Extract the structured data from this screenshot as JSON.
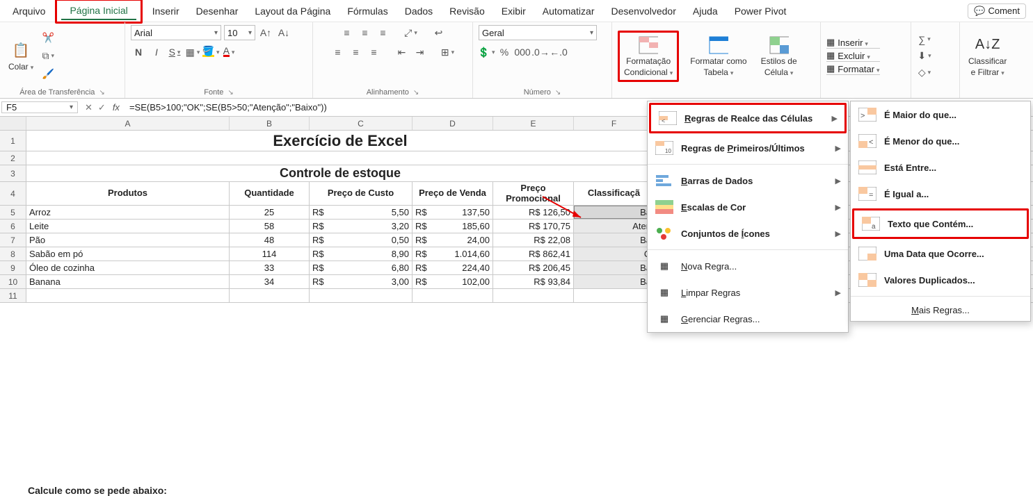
{
  "menubar": {
    "items": [
      "Arquivo",
      "Página Inicial",
      "Inserir",
      "Desenhar",
      "Layout da Página",
      "Fórmulas",
      "Dados",
      "Revisão",
      "Exibir",
      "Automatizar",
      "Desenvolvedor",
      "Ajuda",
      "Power Pivot"
    ],
    "active_index": 1,
    "comment_label": "Coment"
  },
  "ribbon": {
    "clipboard": {
      "paste": "Colar",
      "group_label": "Área de Transferência"
    },
    "font": {
      "name": "Arial",
      "size": "10",
      "group_label": "Fonte",
      "bold": "N",
      "italic": "I",
      "underline": "S"
    },
    "alignment": {
      "group_label": "Alinhamento"
    },
    "number": {
      "format": "Geral",
      "group_label": "Número"
    },
    "styles": {
      "cond_fmt_line1": "Formatação",
      "cond_fmt_line2": "Condicional",
      "fmt_table_line1": "Formatar como",
      "fmt_table_line2": "Tabela",
      "cell_styles_line1": "Estilos de",
      "cell_styles_line2": "Célula"
    },
    "cells": {
      "insert": "Inserir",
      "delete": "Excluir",
      "format": "Formatar"
    },
    "editing": {
      "sort_line1": "Classificar",
      "sort_line2": "e Filtrar"
    }
  },
  "formula_bar": {
    "name_box": "F5",
    "formula": "=SE(B5>100;\"OK\";SE(B5>50;\"Atenção\";\"Baixo\"))"
  },
  "grid": {
    "columns": [
      "A",
      "B",
      "C",
      "D",
      "E",
      "F"
    ],
    "title": "Exercício de Excel",
    "subtitle": "Controle de estoque",
    "headers": [
      "Produtos",
      "Quantidade",
      "Preço de Custo",
      "Preço de Venda",
      "Preço Promocional",
      "Classificaçã"
    ],
    "rows": [
      {
        "r": 5,
        "produto": "Arroz",
        "qtd": "25",
        "custo": "5,50",
        "venda": "137,50",
        "promo": "R$ 126,50",
        "classif": "Ba"
      },
      {
        "r": 6,
        "produto": "Leite",
        "qtd": "58",
        "custo": "3,20",
        "venda": "185,60",
        "promo": "R$ 170,75",
        "classif": "Aten"
      },
      {
        "r": 7,
        "produto": "Pão",
        "qtd": "48",
        "custo": "0,50",
        "venda": "24,00",
        "promo": "R$ 22,08",
        "classif": "Ba"
      },
      {
        "r": 8,
        "produto": "Sabão em pó",
        "qtd": "114",
        "custo": "8,90",
        "venda": "1.014,60",
        "promo": "R$ 862,41",
        "classif": "O"
      },
      {
        "r": 9,
        "produto": "Óleo de cozinha",
        "qtd": "33",
        "custo": "6,80",
        "venda": "224,40",
        "promo": "R$ 206,45",
        "classif": "Ba"
      },
      {
        "r": 10,
        "produto": "Banana",
        "qtd": "34",
        "custo": "3,00",
        "venda": "102,00",
        "promo": "R$ 93,84",
        "classif": "Ba"
      }
    ],
    "row11": "11",
    "currency": "R$",
    "bottom_partial": "Calcule como se pede abaixo:"
  },
  "dropdown1": {
    "items": [
      {
        "label": "Regras de Realce das Células",
        "u": 0,
        "arrow": true,
        "highlight": true
      },
      {
        "label": "Regras de Primeiros/Últimos",
        "u": 10,
        "arrow": true
      },
      {
        "label": "Barras de Dados",
        "u": 0,
        "arrow": true
      },
      {
        "label": "Escalas de Cor",
        "u": 0,
        "arrow": true
      },
      {
        "label": "Conjuntos de Ícones",
        "u": 13,
        "arrow": true
      }
    ],
    "footer": [
      {
        "label": "Nova Regra...",
        "u": 0
      },
      {
        "label": "Limpar Regras",
        "u": 0,
        "arrow": true
      },
      {
        "label": "Gerenciar Regras...",
        "u": 0
      }
    ]
  },
  "dropdown2": {
    "items": [
      {
        "label": "É Maior do que..."
      },
      {
        "label": "É Menor do que..."
      },
      {
        "label": "Está Entre..."
      },
      {
        "label": "É Igual a..."
      },
      {
        "label": "Texto que Contém...",
        "highlight": true
      },
      {
        "label": "Uma Data que Ocorre..."
      },
      {
        "label": "Valores Duplicados..."
      }
    ],
    "footer": {
      "label": "Mais Regras..."
    }
  }
}
